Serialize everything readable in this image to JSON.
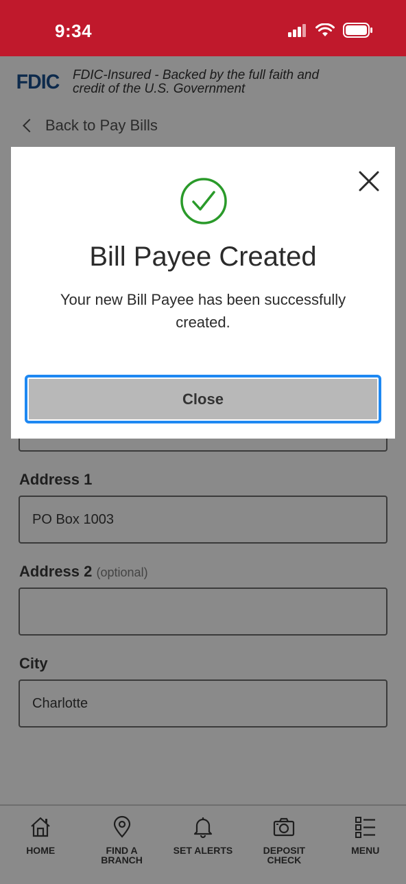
{
  "status_bar": {
    "time": "9:34"
  },
  "fdic": {
    "logo": "FDIC",
    "text_line1": "FDIC-Insured - Backed by the full faith and",
    "text_line2": "credit of the U.S. Government"
  },
  "back_link": {
    "label": "Back to Pay Bills"
  },
  "form": {
    "address1": {
      "label": "Address 1",
      "value": "PO Box 1003"
    },
    "address2": {
      "label": "Address 2",
      "optional": "(optional)",
      "value": ""
    },
    "city": {
      "label": "City",
      "value": "Charlotte"
    }
  },
  "modal": {
    "title": "Bill Payee Created",
    "message": "Your new Bill Payee has been successfully created.",
    "close_button": "Close"
  },
  "bottom_nav": {
    "items": [
      {
        "label": "HOME",
        "icon": "home-icon"
      },
      {
        "label": "FIND A BRANCH",
        "icon": "location-pin-icon"
      },
      {
        "label": "SET ALERTS",
        "icon": "bell-icon"
      },
      {
        "label": "DEPOSIT CHECK",
        "icon": "camera-icon"
      },
      {
        "label": "MENU",
        "icon": "menu-list-icon"
      }
    ]
  },
  "colors": {
    "brand_red": "#c0192c",
    "success_green": "#2a9a2a",
    "focus_blue": "#1e88f2",
    "overlay_gray": "#8a8a8a"
  }
}
